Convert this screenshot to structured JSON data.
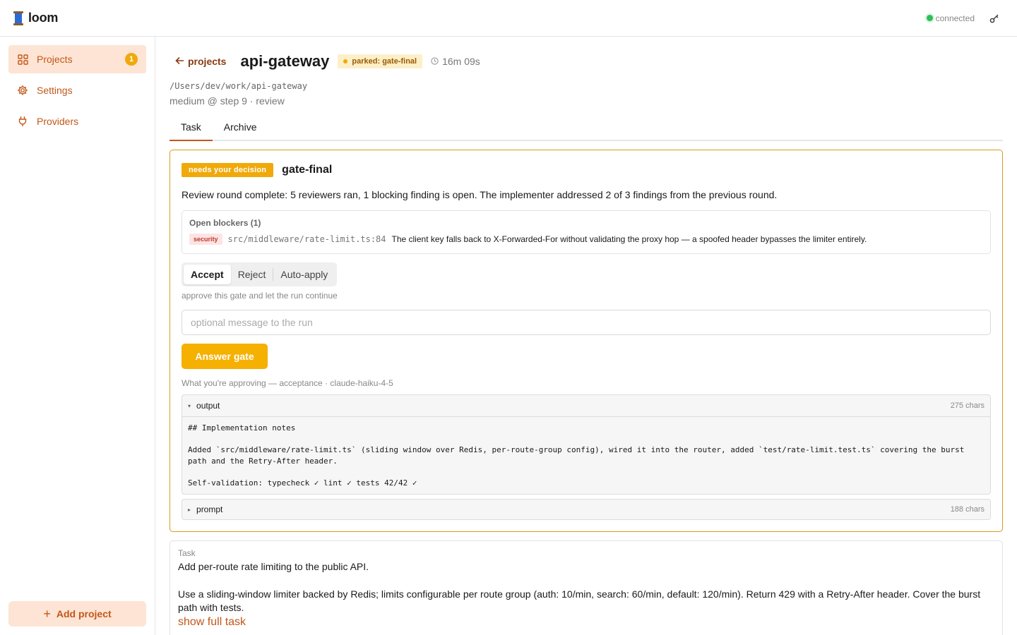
{
  "app": {
    "name": "loom"
  },
  "topbar": {
    "connection_status": "connected"
  },
  "sidebar": {
    "items": [
      {
        "label": "Projects",
        "badge": "1"
      },
      {
        "label": "Settings"
      },
      {
        "label": "Providers"
      }
    ],
    "add_project_label": "Add project"
  },
  "header": {
    "back_label": "projects",
    "title": "api-gateway",
    "status": "parked: gate-final",
    "elapsed": "16m 09s",
    "path": "/Users/dev/work/api-gateway",
    "subtitle": "medium @ step 9 · review"
  },
  "tabs": [
    {
      "label": "Task"
    },
    {
      "label": "Archive"
    }
  ],
  "gate": {
    "badge": "needs your decision",
    "name": "gate-final",
    "summary": "Review round complete: 5 reviewers ran, 1 blocking finding is open. The implementer addressed 2 of 3 findings from the previous round.",
    "blockers_title": "Open blockers (1)",
    "blockers": [
      {
        "tag": "security",
        "file": "src/middleware/rate-limit.ts:84",
        "text": "The client key falls back to X-Forwarded-For without validating the proxy hop — a spoofed header bypasses the limiter entirely."
      }
    ],
    "options": [
      "Accept",
      "Reject",
      "Auto-apply"
    ],
    "selected_option": "Accept",
    "option_hint": "approve this gate and let the run continue",
    "message_placeholder": "optional message to the run",
    "message_value": "",
    "answer_label": "Answer gate",
    "approving_label": "What you're approving — acceptance · claude-haiku-4-5",
    "output": {
      "label": "output",
      "chars": "275 chars",
      "lines": [
        "## Implementation notes",
        "Added `src/middleware/rate-limit.ts` (sliding window over Redis, per-route-group config), wired it into the router, added `test/rate-limit.test.ts` covering the burst path and the Retry-After header.",
        "Self-validation: typecheck ✓ lint ✓ tests 42/42 ✓"
      ]
    },
    "prompt": {
      "label": "prompt",
      "chars": "188 chars"
    }
  },
  "task": {
    "label": "Task",
    "line1": "Add per-route rate limiting to the public API.",
    "line2": "Use a sliding-window limiter backed by Redis; limits configurable per route group (auth: 10/min, search: 60/min, default: 120/min). Return 429 with a Retry-After header. Cover the burst path with tests.",
    "show_full_label": "show full task"
  },
  "colors": {
    "accent": "#c2571a",
    "warning": "#f0a90a",
    "connected": "#2fbf55",
    "danger": "#c0392b"
  },
  "icons": {
    "logo": "spool-icon",
    "topbar_right": "key-icon",
    "projects": "grid-icon",
    "settings": "gear-icon",
    "providers": "plug-icon",
    "back": "arrow-left-icon",
    "timer": "clock-icon",
    "add": "plus-icon"
  }
}
